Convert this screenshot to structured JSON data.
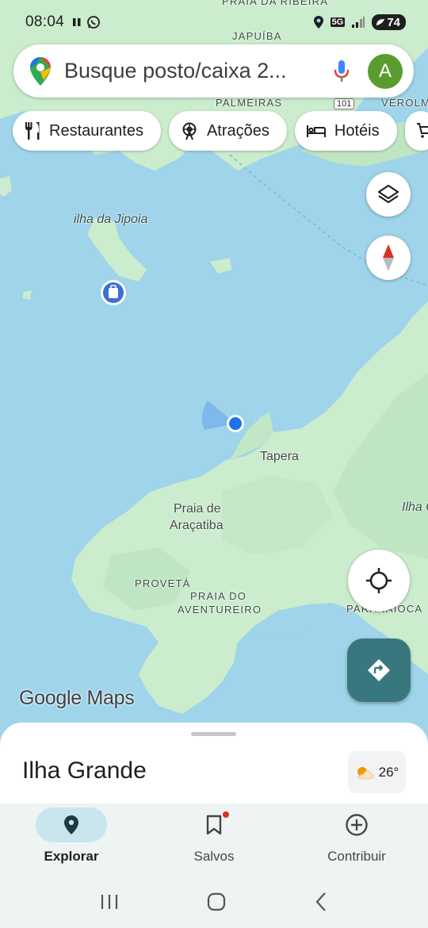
{
  "status_bar": {
    "time": "08:04",
    "network": "5G",
    "battery": "74"
  },
  "search": {
    "placeholder": "Busque posto/caixa 2...",
    "avatar_letter": "A"
  },
  "chips": [
    {
      "label": "Restaurantes",
      "icon": "fork-knife-icon"
    },
    {
      "label": "Atrações",
      "icon": "ferris-wheel-icon"
    },
    {
      "label": "Hotéis",
      "icon": "bed-icon"
    }
  ],
  "map": {
    "labels": {
      "ribeira": "PRAIA DA RIBEIRA",
      "japuiba": "JAPUÍBA",
      "palmeiras": "PALMEIRAS",
      "verolme": "VEROLM",
      "route": "101",
      "jipoia": "ilha da Jipoia",
      "tapera": "Tapera",
      "aracatiba_1": "Praia de",
      "aracatiba_2": "Araçatiba",
      "proveta": "PROVETÁ",
      "aventureiro_1": "PRAIA DO",
      "aventureiro_2": "AVENTUREIRO",
      "ilha": "Ilha G",
      "paranaioca": "PARANAIOCA"
    },
    "attribution": "Google Maps"
  },
  "sheet": {
    "title": "Ilha Grande",
    "temperature": "26°"
  },
  "nav": [
    {
      "label": "Explorar",
      "icon": "explore-pin-icon",
      "active": true
    },
    {
      "label": "Salvos",
      "icon": "bookmark-icon",
      "active": false
    },
    {
      "label": "Contribuir",
      "icon": "add-circle-icon",
      "active": false
    }
  ],
  "colors": {
    "water": "#9fd4ea",
    "land": "#cbeccd",
    "accent": "#39777f",
    "location_dot": "#1a73e8"
  }
}
